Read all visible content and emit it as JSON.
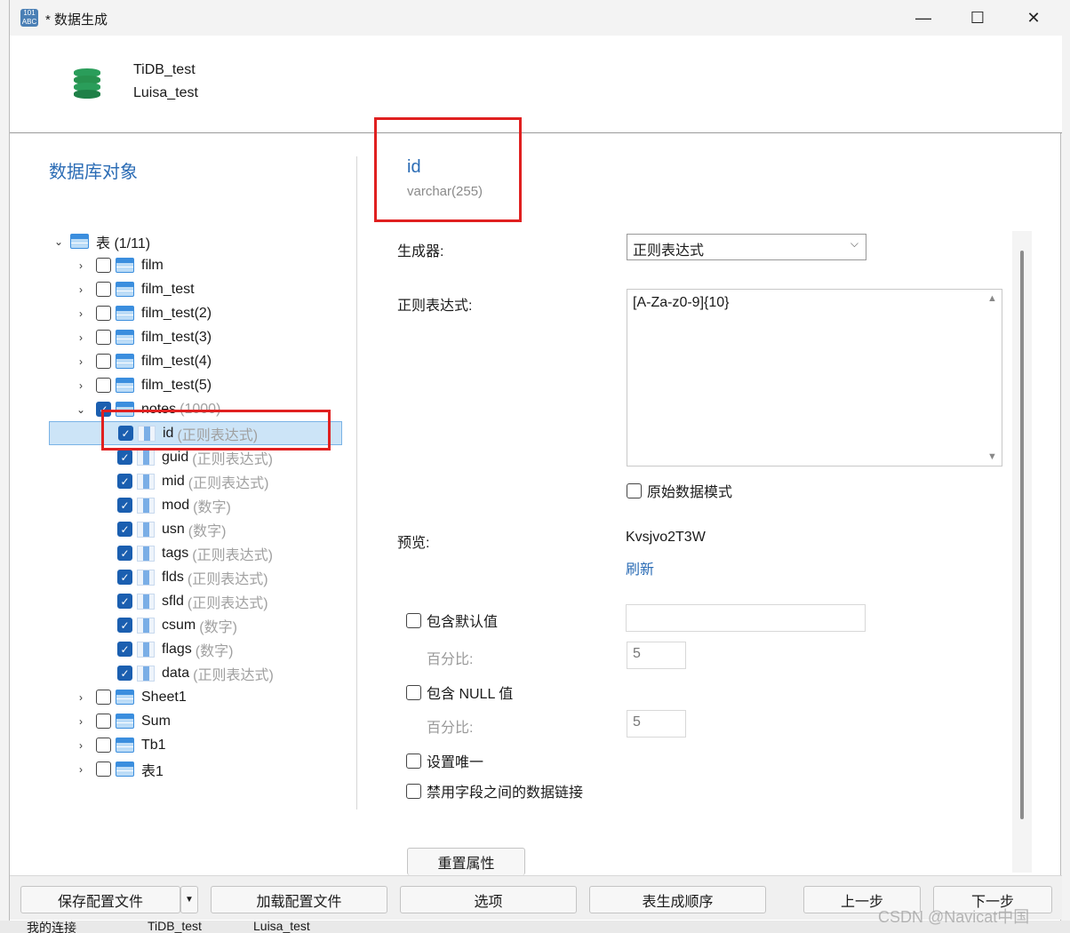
{
  "window": {
    "title": "* 数据生成"
  },
  "header": {
    "connection": "TiDB_test",
    "database": "Luisa_test"
  },
  "left": {
    "title": "数据库对象",
    "root": {
      "label": "表 (1/11)"
    },
    "tables_top": [
      "film",
      "film_test",
      "film_test(2)",
      "film_test(3)",
      "film_test(4)",
      "film_test(5)"
    ],
    "notes": {
      "name": "notes",
      "hint": "(1000)"
    },
    "columns": [
      {
        "name": "id",
        "hint": "(正则表达式)"
      },
      {
        "name": "guid",
        "hint": "(正则表达式)"
      },
      {
        "name": "mid",
        "hint": "(正则表达式)"
      },
      {
        "name": "mod",
        "hint": "(数字)"
      },
      {
        "name": "usn",
        "hint": "(数字)"
      },
      {
        "name": "tags",
        "hint": "(正则表达式)"
      },
      {
        "name": "flds",
        "hint": "(正则表达式)"
      },
      {
        "name": "sfld",
        "hint": "(正则表达式)"
      },
      {
        "name": "csum",
        "hint": "(数字)"
      },
      {
        "name": "flags",
        "hint": "(数字)"
      },
      {
        "name": "data",
        "hint": "(正则表达式)"
      }
    ],
    "tables_bottom": [
      "Sheet1",
      "Sum",
      "Tb1",
      "表1"
    ]
  },
  "right": {
    "field_name": "id",
    "field_type": "varchar(255)",
    "generator_label": "生成器:",
    "generator_value": "正则表达式",
    "regex_label": "正则表达式:",
    "regex_value": "[A-Za-z0-9]{10}",
    "raw_mode_label": "原始数据模式",
    "preview_label": "预览:",
    "preview_value": "Kvsjvo2T3W",
    "refresh_label": "刷新",
    "include_default_label": "包含默认值",
    "percent_label": "百分比:",
    "percent_default": "5",
    "include_null_label": "包含 NULL 值",
    "percent_null": "5",
    "unique_label": "设置唯一",
    "disable_link_label": "禁用字段之间的数据链接",
    "reset_button": "重置属性"
  },
  "footer": {
    "save_config": "保存配置文件",
    "load_config": "加载配置文件",
    "options": "选项",
    "table_order": "表生成顺序",
    "prev": "上一步",
    "next": "下一步"
  },
  "taskbar": {
    "item1": "我的连接",
    "item2": "TiDB_test",
    "item3": "Luisa_test"
  },
  "watermark": "CSDN @Navicat中国"
}
